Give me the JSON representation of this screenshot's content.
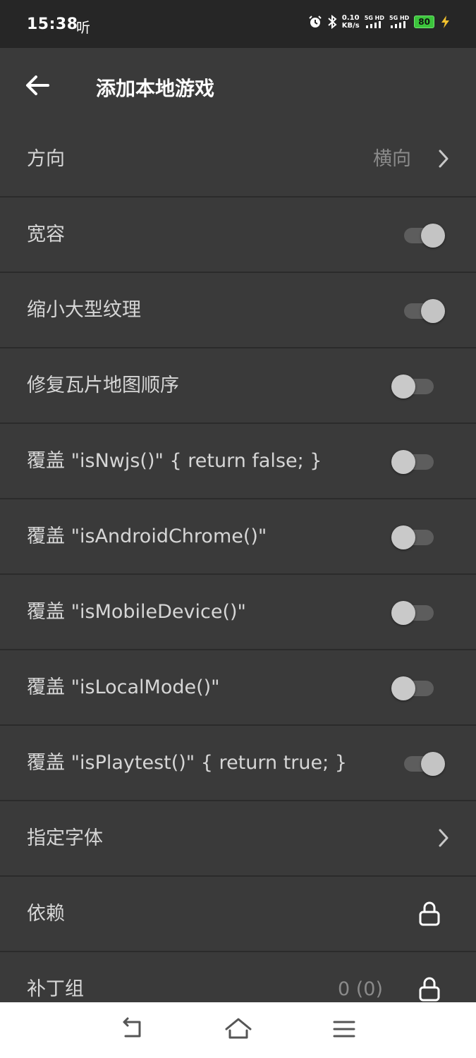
{
  "status_bar": {
    "time": "15:38",
    "ting": "听",
    "speed_value": "0.10",
    "speed_unit": "KB/s",
    "signal_1": "5G HD",
    "signal_2": "5G HD",
    "battery": "80"
  },
  "header": {
    "title": "添加本地游戏"
  },
  "settings": {
    "orientation": {
      "label": "方向",
      "value": "横向"
    },
    "lenient": {
      "label": "宽容",
      "on": true
    },
    "shrink_textures": {
      "label": "缩小大型纹理",
      "on": true
    },
    "fix_tilemap": {
      "label": "修复瓦片地图顺序",
      "on": false
    },
    "override_isnwjs": {
      "label": "覆盖 \"isNwjs()\" { return false; }",
      "on": false
    },
    "override_isandroidchrome": {
      "label": "覆盖 \"isAndroidChrome()\"",
      "on": false
    },
    "override_ismobiledevice": {
      "label": "覆盖 \"isMobileDevice()\"",
      "on": false
    },
    "override_islocalmode": {
      "label": "覆盖 \"isLocalMode()\"",
      "on": false
    },
    "override_isplaytest": {
      "label": "覆盖 \"isPlaytest()\" { return true; }",
      "on": true
    },
    "font": {
      "label": "指定字体"
    },
    "dependencies": {
      "label": "依赖"
    },
    "patch_group": {
      "label": "补丁组",
      "value": "0 (0)"
    }
  },
  "icons": {
    "back": "arrow-left-icon",
    "chevron": "chevron-right-icon",
    "lock": "lock-icon",
    "nav_back": "return-icon",
    "nav_home": "home-icon",
    "nav_menu": "menu-icon"
  },
  "colors": {
    "background": "#383838",
    "status_bar": "#262626",
    "battery": "#3cc43c"
  }
}
